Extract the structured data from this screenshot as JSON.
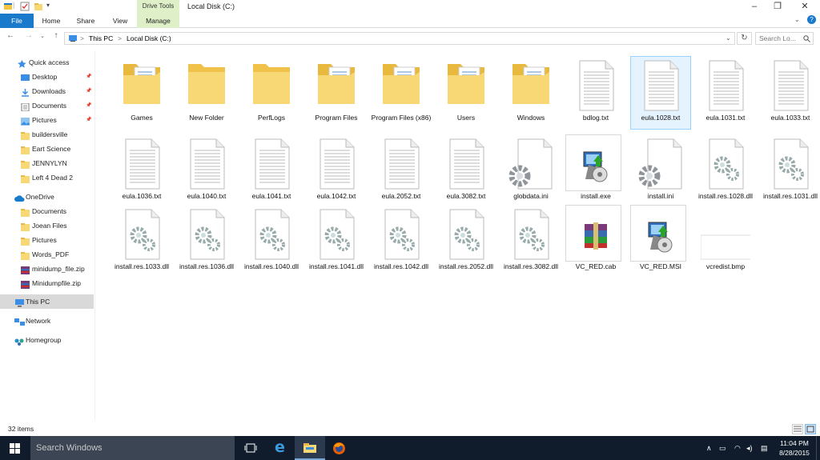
{
  "window": {
    "title": "Local Disk (C:)",
    "context_tab": "Drive Tools",
    "minimize": "–",
    "maximize": "❐",
    "close": "✕"
  },
  "ribbon": {
    "tabs": [
      "File",
      "Home",
      "Share",
      "View",
      "Manage"
    ]
  },
  "address": {
    "crumbs": [
      "This PC",
      "Local Disk (C:)"
    ],
    "separator": ">",
    "search_placeholder": "Search Lo..."
  },
  "sidebar": {
    "items": [
      {
        "label": "Quick access",
        "icon": "star-icon",
        "pinned": false
      },
      {
        "label": "Desktop",
        "icon": "desktop-icon",
        "pinned": true
      },
      {
        "label": "Downloads",
        "icon": "download-icon",
        "pinned": true
      },
      {
        "label": "Documents",
        "icon": "documents-icon",
        "pinned": true
      },
      {
        "label": "Pictures",
        "icon": "pictures-icon",
        "pinned": true
      },
      {
        "label": "buildersville",
        "icon": "folder-icon",
        "pinned": false
      },
      {
        "label": "Eart Science",
        "icon": "folder-icon",
        "pinned": false
      },
      {
        "label": "JENNYLYN",
        "icon": "folder-icon",
        "pinned": false
      },
      {
        "label": "Left 4 Dead 2",
        "icon": "folder-icon",
        "pinned": false
      },
      {
        "label": "OneDrive",
        "icon": "cloud-icon",
        "pinned": false
      },
      {
        "label": "Documents",
        "icon": "folder-icon",
        "pinned": false
      },
      {
        "label": "Joean Files",
        "icon": "folder-icon",
        "pinned": false
      },
      {
        "label": "Pictures",
        "icon": "folder-icon",
        "pinned": false
      },
      {
        "label": "Words_PDF",
        "icon": "folder-icon",
        "pinned": false
      },
      {
        "label": "minidump_file.zip",
        "icon": "archive-icon",
        "pinned": false
      },
      {
        "label": "Minidumpfile.zip",
        "icon": "archive-icon",
        "pinned": false
      },
      {
        "label": "This PC",
        "icon": "computer-icon",
        "pinned": false
      },
      {
        "label": "Network",
        "icon": "network-icon",
        "pinned": false
      },
      {
        "label": "Homegroup",
        "icon": "homegroup-icon",
        "pinned": false
      }
    ]
  },
  "files": [
    {
      "name": "Games",
      "type": "folder-docs"
    },
    {
      "name": "New Folder",
      "type": "folder"
    },
    {
      "name": "PerfLogs",
      "type": "folder"
    },
    {
      "name": "Program Files",
      "type": "folder-docs"
    },
    {
      "name": "Program Files (x86)",
      "type": "folder-docs"
    },
    {
      "name": "Users",
      "type": "folder-docs"
    },
    {
      "name": "Windows",
      "type": "folder-docs"
    },
    {
      "name": "bdlog.txt",
      "type": "text"
    },
    {
      "name": "eula.1028.txt",
      "type": "text"
    },
    {
      "name": "eula.1031.txt",
      "type": "text"
    },
    {
      "name": "eula.1033.txt",
      "type": "text"
    },
    {
      "name": "eula.1036.txt",
      "type": "text"
    },
    {
      "name": "eula.1040.txt",
      "type": "text"
    },
    {
      "name": "eula.1041.txt",
      "type": "text"
    },
    {
      "name": "eula.1042.txt",
      "type": "text"
    },
    {
      "name": "eula.2052.txt",
      "type": "text"
    },
    {
      "name": "eula.3082.txt",
      "type": "text"
    },
    {
      "name": "globdata.ini",
      "type": "ini"
    },
    {
      "name": "install.exe",
      "type": "installer"
    },
    {
      "name": "install.ini",
      "type": "ini"
    },
    {
      "name": "install.res.1028.dll",
      "type": "dll"
    },
    {
      "name": "install.res.1031.dll",
      "type": "dll"
    },
    {
      "name": "install.res.1033.dll",
      "type": "dll"
    },
    {
      "name": "install.res.1036.dll",
      "type": "dll"
    },
    {
      "name": "install.res.1040.dll",
      "type": "dll"
    },
    {
      "name": "install.res.1041.dll",
      "type": "dll"
    },
    {
      "name": "install.res.1042.dll",
      "type": "dll"
    },
    {
      "name": "install.res.2052.dll",
      "type": "dll"
    },
    {
      "name": "install.res.3082.dll",
      "type": "dll"
    },
    {
      "name": "VC_RED.cab",
      "type": "cab"
    },
    {
      "name": "VC_RED.MSI",
      "type": "installer"
    },
    {
      "name": "vcredist.bmp",
      "type": "bmp"
    }
  ],
  "selected_file": "eula.1028.txt",
  "status": {
    "item_count": "32 items"
  },
  "taskbar": {
    "search_placeholder": "Search Windows",
    "time": "11:04 PM",
    "date": "8/28/2015"
  },
  "colors": {
    "accent": "#1979ca",
    "taskbar": "#101c2c",
    "folder": "#f8d775",
    "selection": "#e5f3ff"
  }
}
